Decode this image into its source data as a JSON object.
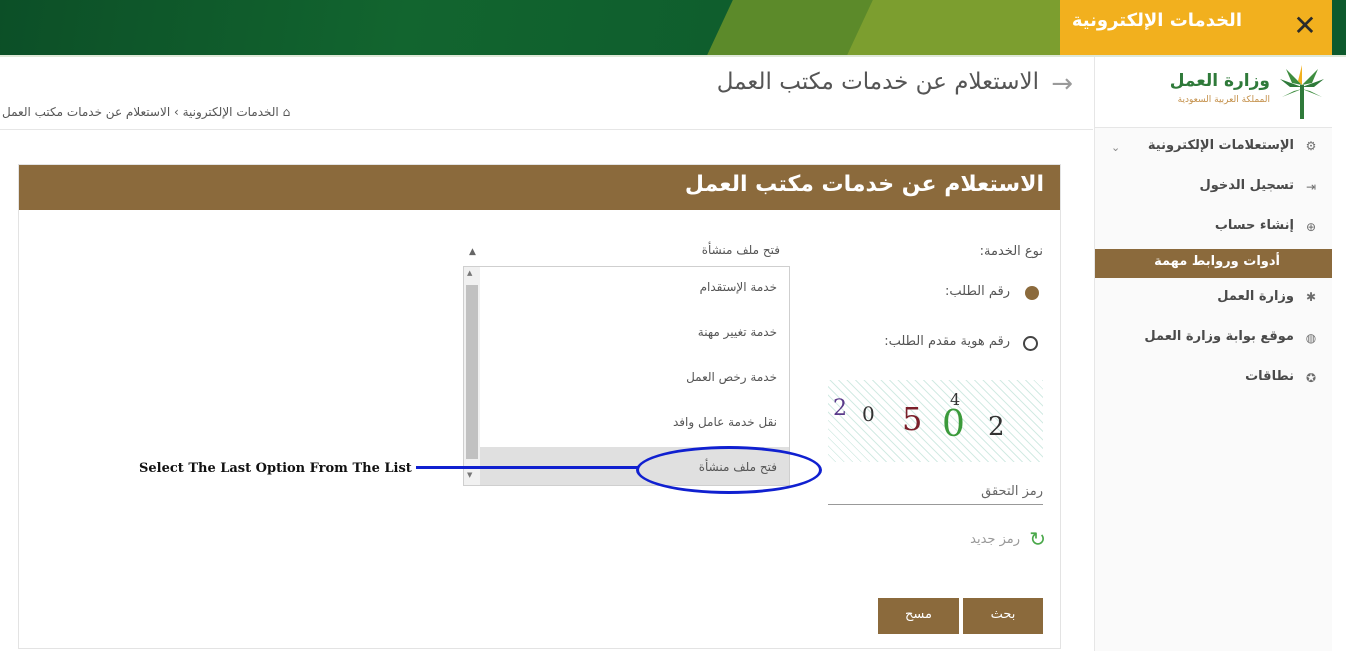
{
  "topbar": {
    "title": "الخدمات الإلكترونية",
    "close_icon": "close-icon"
  },
  "sidebar": {
    "logo_name": "وزارة العمل",
    "logo_sub": "المملكة العربية السعودية",
    "section_label": "الإستعلامات الإلكترونية",
    "login_label": "تسجيل الدخول",
    "create_account_label": "إنشاء حساب",
    "tools_label": "أدوات وروابط مهمة",
    "ministry_label": "وزارة العمل",
    "portal_label": "موقع بوابة وزارة العمل",
    "nitaqat_label": "نطاقات"
  },
  "page": {
    "title": "الاستعلام عن خدمات مكتب العمل",
    "breadcrumb_home": "الخدمات الإلكترونية",
    "breadcrumb_current": "الاستعلام عن خدمات مكتب العمل"
  },
  "card": {
    "title": "الاستعلام عن خدمات مكتب العمل",
    "service_type_label": "نوع الخدمة:",
    "radio_request_label": "رقم الطلب:",
    "radio_id_label": "رقم هوية مقدم الطلب:",
    "captcha_chars": [
      "2",
      "0",
      "5",
      "0",
      "4",
      "2"
    ],
    "verify_placeholder": "رمز التحقق",
    "new_code_label": "رمز جديد",
    "search_button": "بحث",
    "clear_button": "مسح"
  },
  "service_select": {
    "selected": "فتح ملف منشأة",
    "options": [
      "خدمة الإستقدام",
      "خدمة تغيير مهنة",
      "خدمة رخص العمل",
      "نقل خدمة عامل وافد",
      "فتح ملف منشأة"
    ]
  },
  "annotation": {
    "text": "Select The Last Option From The List"
  },
  "colors": {
    "brown": "#8b6a3c",
    "green": "#0e5a2d",
    "yellow": "#f2b01e",
    "annotation_blue": "#1020d0"
  }
}
